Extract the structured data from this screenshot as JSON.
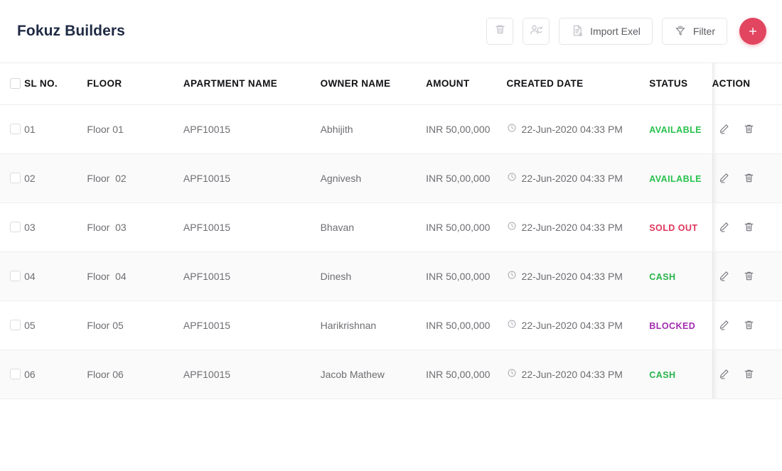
{
  "header": {
    "title": "Fokuz Builders",
    "toolbar": {
      "delete_icon": "trash-icon",
      "assign_icon": "assign-user-icon",
      "import_label": "Import Exel",
      "import_icon": "document-icon",
      "filter_label": "Filter",
      "filter_icon": "funnel-icon",
      "add_label": "+",
      "add_icon": "plus-icon",
      "accent_color": "#e2455f"
    }
  },
  "table": {
    "columns": [
      {
        "key": "select",
        "label": ""
      },
      {
        "key": "sl_no",
        "label": "SL NO."
      },
      {
        "key": "floor",
        "label": "FLOOR"
      },
      {
        "key": "apartment_name",
        "label": "APARTMENT NAME"
      },
      {
        "key": "owner_name",
        "label": "OWNER NAME"
      },
      {
        "key": "amount",
        "label": "AMOUNT"
      },
      {
        "key": "created_date",
        "label": "CREATED DATE"
      },
      {
        "key": "status",
        "label": "STATUS"
      },
      {
        "key": "action",
        "label": "ACTION"
      }
    ],
    "status_colors": {
      "AVAILABLE": "#27c24c",
      "SOLD OUT": "#e0365c",
      "CASH": "#27b34a",
      "BLOCKED": "#a32cb0"
    },
    "row_icons": {
      "clock": "clock-icon",
      "edit": "pencil-icon",
      "delete": "trash-icon"
    },
    "rows": [
      {
        "sl_no": "01",
        "floor": "Floor 01",
        "apartment_name": "APF10015",
        "owner_name": "Abhijith",
        "amount": "INR 50,00,000",
        "created_date": "22-Jun-2020 04:33 PM",
        "status": "AVAILABLE",
        "selected": false
      },
      {
        "sl_no": "02",
        "floor": "Floor  02",
        "apartment_name": "APF10015",
        "owner_name": "Agnivesh",
        "amount": "INR 50,00,000",
        "created_date": "22-Jun-2020 04:33 PM",
        "status": "AVAILABLE",
        "selected": false
      },
      {
        "sl_no": "03",
        "floor": "Floor  03",
        "apartment_name": "APF10015",
        "owner_name": "Bhavan",
        "amount": "INR 50,00,000",
        "created_date": "22-Jun-2020 04:33 PM",
        "status": "SOLD OUT",
        "selected": false
      },
      {
        "sl_no": "04",
        "floor": "Floor  04",
        "apartment_name": "APF10015",
        "owner_name": "Dinesh",
        "amount": "INR 50,00,000",
        "created_date": "22-Jun-2020 04:33 PM",
        "status": "CASH",
        "selected": false
      },
      {
        "sl_no": "05",
        "floor": "Floor 05",
        "apartment_name": "APF10015",
        "owner_name": "Harikrishnan",
        "amount": "INR 50,00,000",
        "created_date": "22-Jun-2020 04:33 PM",
        "status": "BLOCKED",
        "selected": false
      },
      {
        "sl_no": "06",
        "floor": "Floor 06",
        "apartment_name": "APF10015",
        "owner_name": "Jacob Mathew",
        "amount": "INR 50,00,000",
        "created_date": "22-Jun-2020 04:33 PM",
        "status": "CASH",
        "selected": false
      }
    ]
  }
}
